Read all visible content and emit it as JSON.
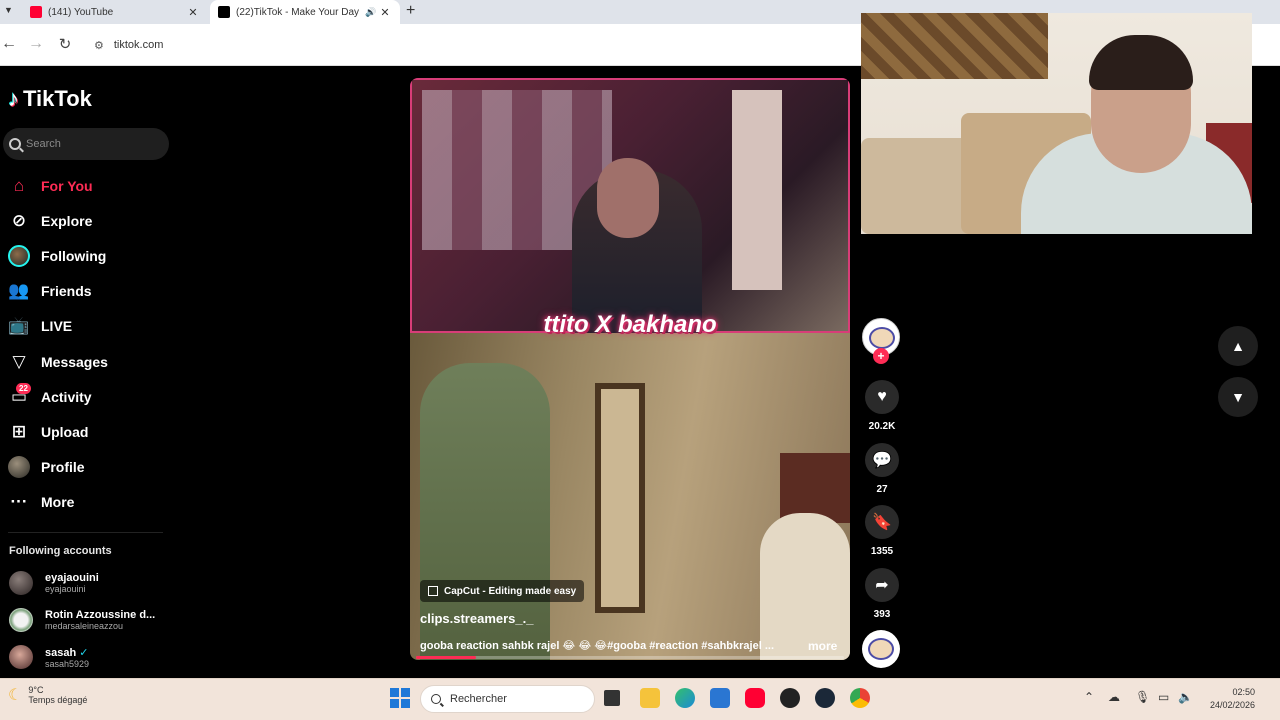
{
  "browser": {
    "tabs": [
      {
        "title": "(141) YouTube",
        "favicon": "youtube-icon",
        "active": false
      },
      {
        "title": "(22)TikTok - Make Your Day",
        "favicon": "tiktok-icon",
        "active": true
      }
    ],
    "url": "tiktok.com"
  },
  "tiktok": {
    "logo_text": "TikTok",
    "search_placeholder": "Search",
    "menu": [
      {
        "label": "For You",
        "icon": "home-icon",
        "active": true
      },
      {
        "label": "Explore",
        "icon": "compass-icon"
      },
      {
        "label": "Following",
        "icon": "following-avatar-icon"
      },
      {
        "label": "Friends",
        "icon": "friends-icon"
      },
      {
        "label": "LIVE",
        "icon": "live-icon"
      },
      {
        "label": "Messages",
        "icon": "messages-icon"
      },
      {
        "label": "Activity",
        "icon": "activity-icon",
        "badge": "22"
      },
      {
        "label": "Upload",
        "icon": "upload-icon"
      },
      {
        "label": "Profile",
        "icon": "profile-avatar-icon"
      },
      {
        "label": "More",
        "icon": "more-icon"
      }
    ],
    "following_title": "Following accounts",
    "accounts": [
      {
        "name": "eyajaouini",
        "handle": "eyajaouini"
      },
      {
        "name": "Rotin Azzoussine d...",
        "handle": "medarsaleineazzou"
      },
      {
        "name": "sasah",
        "handle": "sasah5929"
      }
    ],
    "video": {
      "overlay_caption": "ttito X bakhano",
      "capcut_label": "CapCut - Editing made easy",
      "username": "clips.streamers_._",
      "description": "gooba reaction sahbk rajel 😂 😂 😂#gooba #reaction #sahbkrajel ...",
      "more_label": "more",
      "progress": 0.14
    },
    "actions": {
      "likes": "20.2K",
      "comments": "27",
      "saves": "1355",
      "shares": "393"
    }
  },
  "taskbar": {
    "temperature": "9°C",
    "weather": "Temps dégagé",
    "search_label": "Rechercher",
    "time": "02:50",
    "date": "24/02/2026"
  },
  "colors": {
    "accent": "#fe2c55",
    "cyan": "#25f4ee"
  }
}
